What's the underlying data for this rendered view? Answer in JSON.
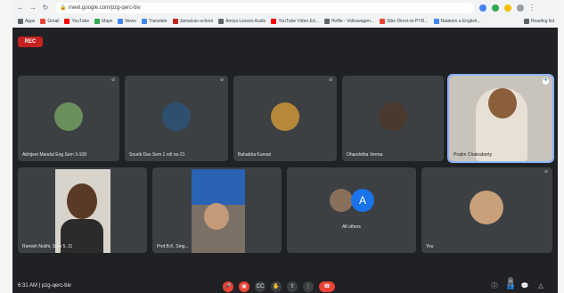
{
  "browser": {
    "url": "meet.google.com/pzg-qerc-biv",
    "bookmarks": [
      "Apps",
      "Gmail",
      "YouTube",
      "Maps",
      "News",
      "Translate",
      "Jamaican-school",
      "Amiya Lesson Audio",
      "YouTube Video Ed...",
      "Hoffie - Volkswagen...",
      "Sibe Direct-to-PYR...",
      "Nadeem a English...",
      "Reading list"
    ],
    "colors": {
      "gmail": "#ea4335",
      "youtube": "#ff0000",
      "maps": "#34a853",
      "news": "#4285f4"
    }
  },
  "meet": {
    "rec_label": "REC",
    "tiles": [
      {
        "name": "Abhijeet Mandal Eng Sem 3-108"
      },
      {
        "name": "Sourik Das Sem 1 roll no-21"
      },
      {
        "name": "Bahabha Kumari"
      },
      {
        "name": "Oharshitha Verma"
      },
      {
        "name": "Pratim Chakraborty"
      },
      {
        "name": "Ramish Nukhi, Sem 5, 11"
      },
      {
        "name": "Prof.B.K. Sing..."
      },
      {
        "name": "All others",
        "avatar_letter": "A"
      },
      {
        "name": "You"
      }
    ],
    "status": {
      "time": "6:31 AM",
      "meeting_code": "pzg-qerc-biv",
      "participants_count": "24"
    }
  }
}
